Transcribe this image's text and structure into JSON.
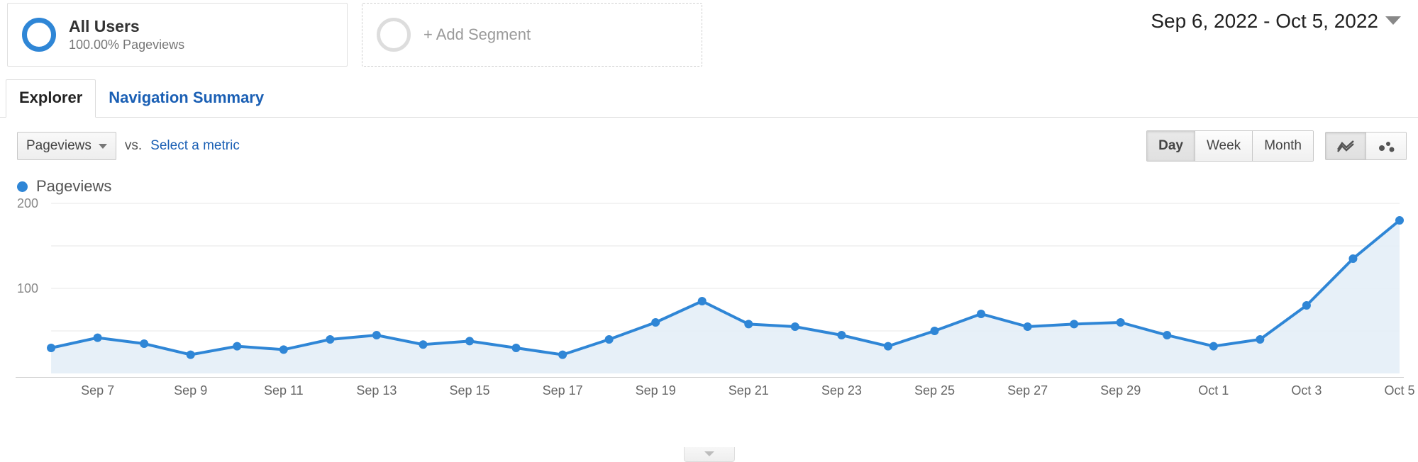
{
  "segments": {
    "primary": {
      "title": "All Users",
      "subtitle": "100.00% Pageviews"
    },
    "add_label": "+ Add Segment"
  },
  "date_range": {
    "label": "Sep 6, 2022 - Oct 5, 2022"
  },
  "tabs": {
    "explorer": "Explorer",
    "nav_summary": "Navigation Summary"
  },
  "controls": {
    "metric_selected": "Pageviews",
    "vs": "vs.",
    "select_metric": "Select a metric",
    "granularity": {
      "day": "Day",
      "week": "Week",
      "month": "Month"
    }
  },
  "legend": {
    "series_name": "Pageviews"
  },
  "chart_data": {
    "type": "line",
    "ylabel": "",
    "xlabel": "",
    "ylim": [
      0,
      200
    ],
    "y_ticks": [
      100,
      200
    ],
    "x": [
      "Sep 6",
      "Sep 7",
      "Sep 8",
      "Sep 9",
      "Sep 10",
      "Sep 11",
      "Sep 12",
      "Sep 13",
      "Sep 14",
      "Sep 15",
      "Sep 16",
      "Sep 17",
      "Sep 18",
      "Sep 19",
      "Sep 20",
      "Sep 21",
      "Sep 22",
      "Sep 23",
      "Sep 24",
      "Sep 25",
      "Sep 26",
      "Sep 27",
      "Sep 28",
      "Sep 29",
      "Sep 30",
      "Oct 1",
      "Oct 2",
      "Oct 3",
      "Oct 4",
      "Oct 5"
    ],
    "x_tick_labels": [
      "Sep 7",
      "Sep 9",
      "Sep 11",
      "Sep 13",
      "Sep 15",
      "Sep 17",
      "Sep 19",
      "Sep 21",
      "Sep 23",
      "Sep 25",
      "Sep 27",
      "Sep 29",
      "Oct 1",
      "Oct 3",
      "Oct 5"
    ],
    "series": [
      {
        "name": "Pageviews",
        "color": "#2f86d6",
        "values": [
          30,
          42,
          35,
          22,
          32,
          28,
          40,
          45,
          34,
          38,
          30,
          22,
          40,
          60,
          85,
          58,
          55,
          45,
          32,
          50,
          70,
          55,
          58,
          60,
          45,
          32,
          40,
          80,
          135,
          180
        ]
      }
    ]
  }
}
